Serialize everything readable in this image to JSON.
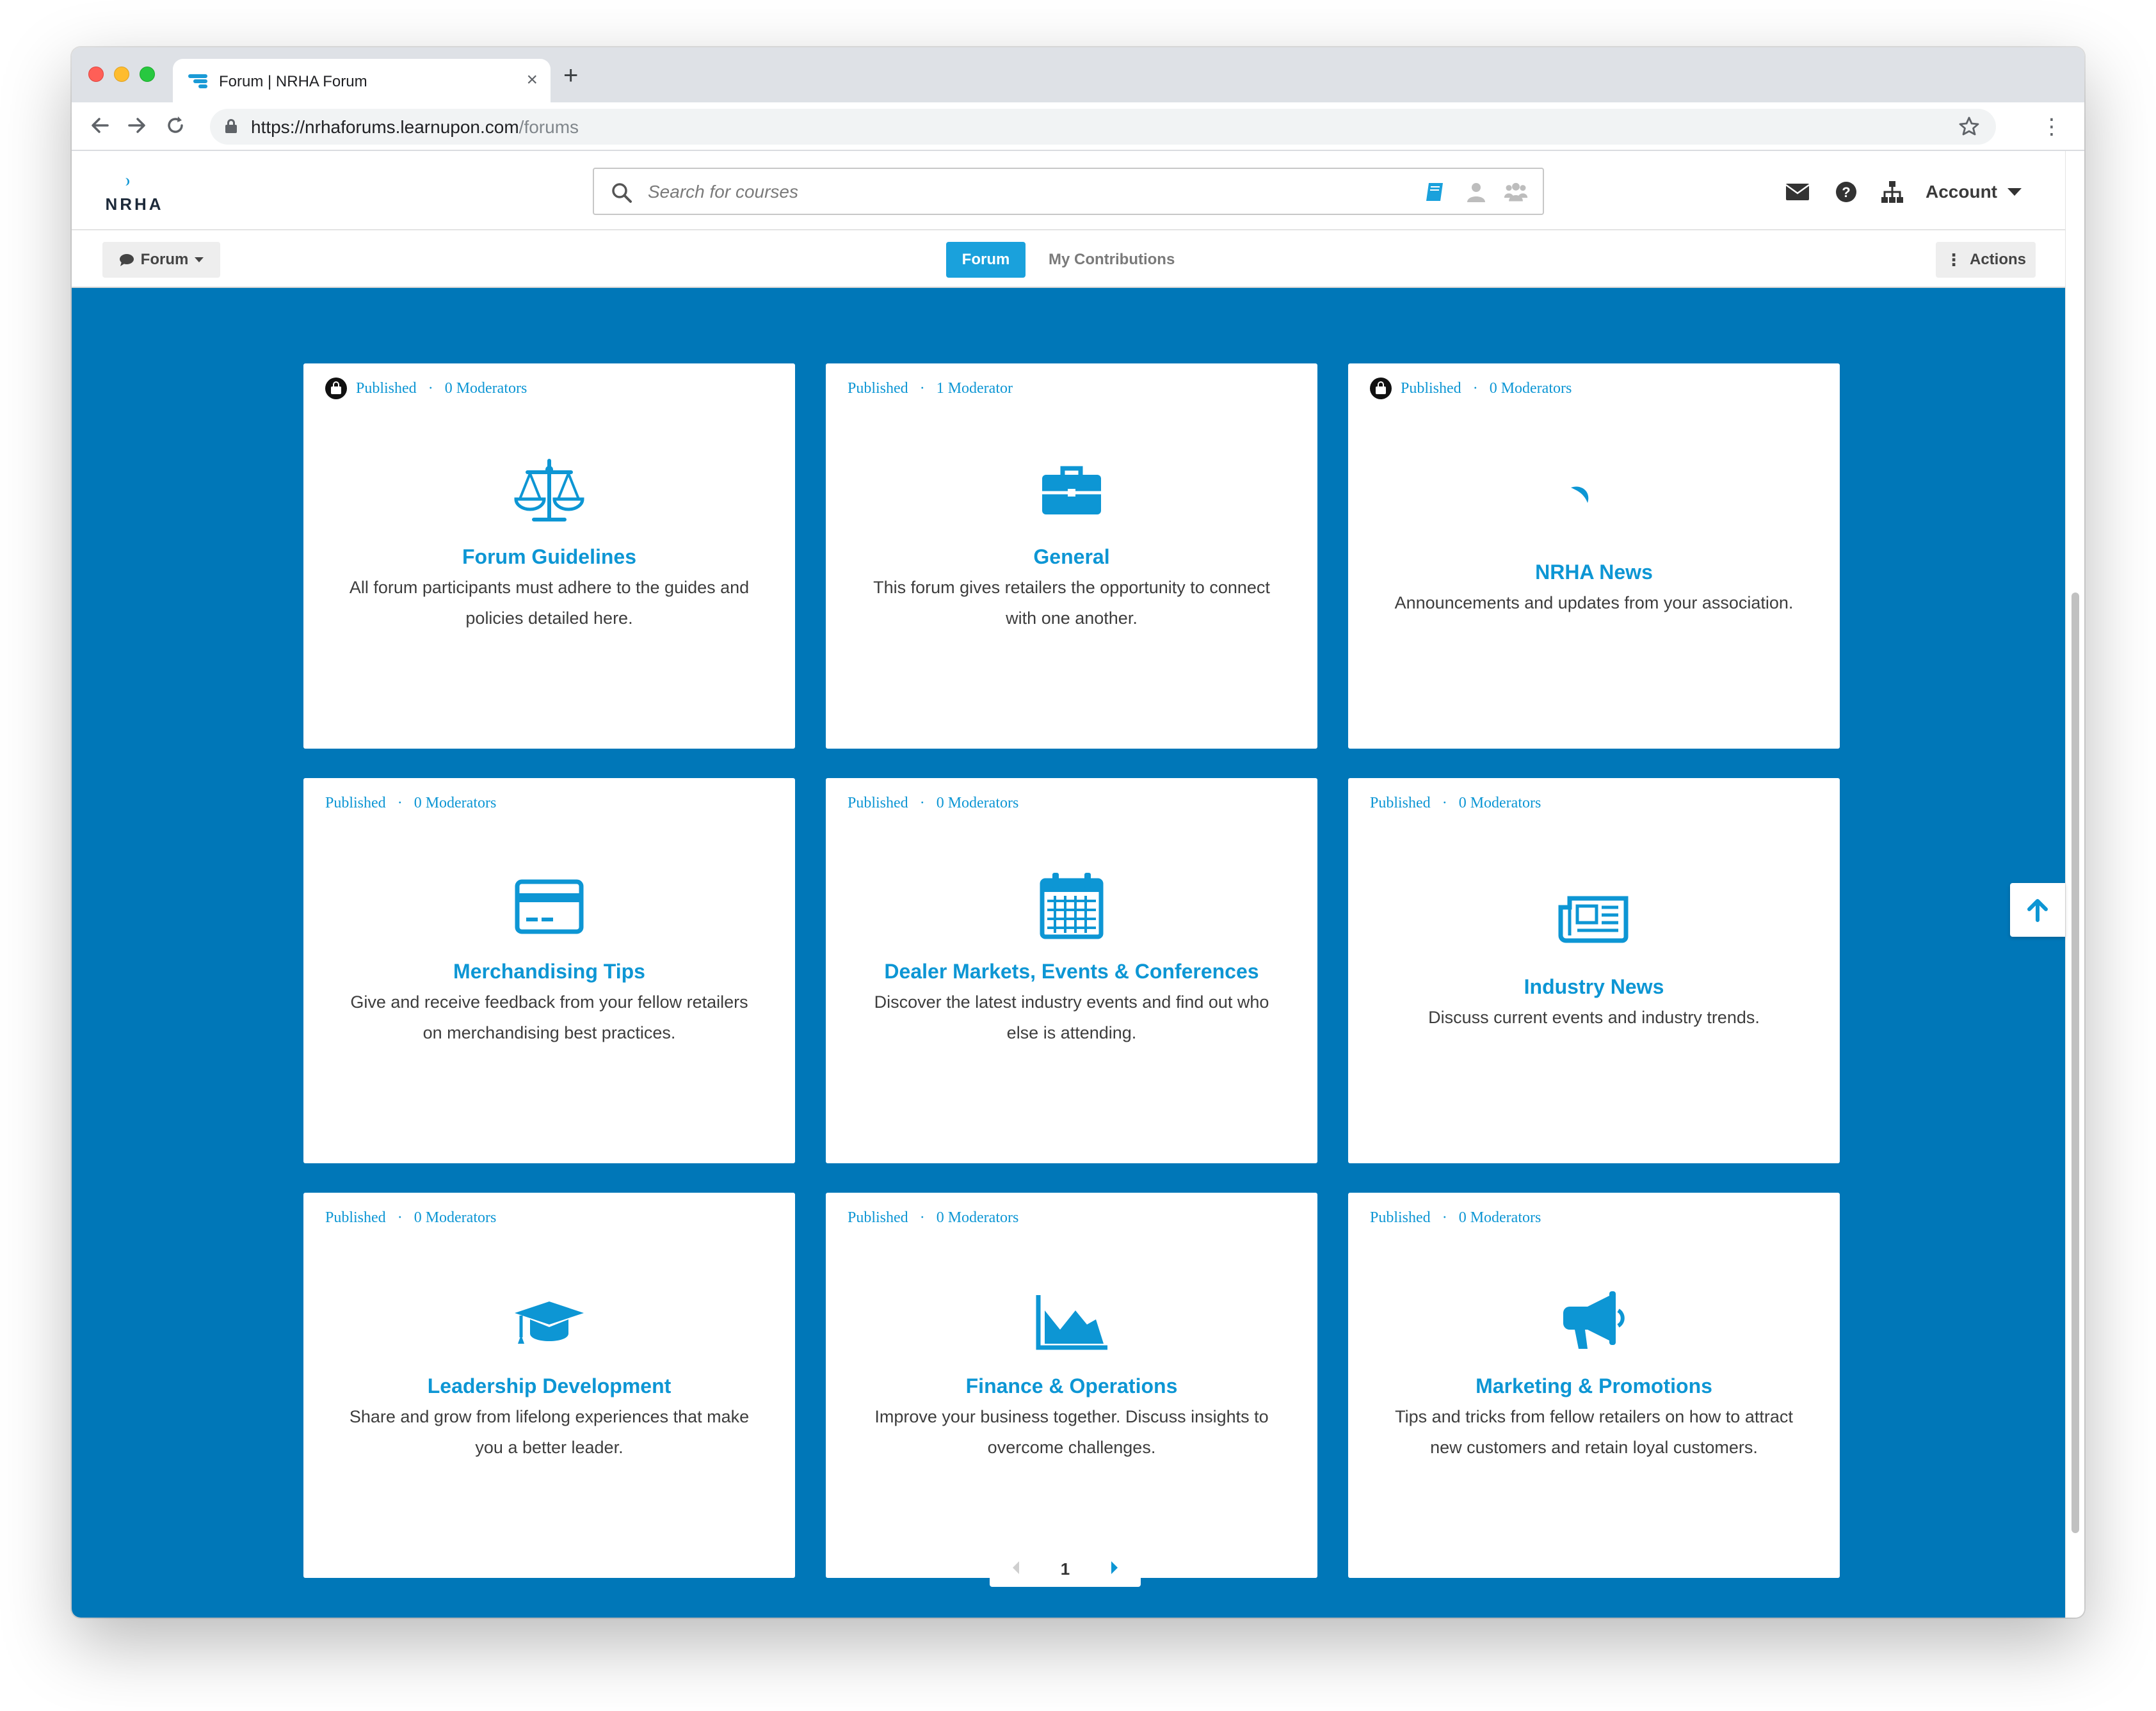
{
  "browser": {
    "tab_title": "Forum | NRHA Forum",
    "url_host": "https://nrhaforums.learnupon.com",
    "url_path": "/forums"
  },
  "header": {
    "logo_text": "NRHA",
    "search_placeholder": "Search for courses",
    "account_label": "Account"
  },
  "subnav": {
    "forum_dropdown": "Forum",
    "tabs": [
      {
        "label": "Forum",
        "active": true
      },
      {
        "label": "My Contributions",
        "active": false
      }
    ],
    "actions_label": "Actions"
  },
  "forums": [
    {
      "status": "Published",
      "moderators": "0 Moderators",
      "locked": true,
      "icon": "scale-icon",
      "title": "Forum Guidelines",
      "description": "All forum participants must adhere to the guides and policies detailed here."
    },
    {
      "status": "Published",
      "moderators": "1 Moderator",
      "locked": false,
      "icon": "briefcase-icon",
      "title": "General",
      "description": "This forum gives retailers the opportunity to connect with one another."
    },
    {
      "status": "Published",
      "moderators": "0 Moderators",
      "locked": true,
      "icon": "nrha-logo-icon",
      "title": "NRHA News",
      "description": "Announcements and updates from your association."
    },
    {
      "status": "Published",
      "moderators": "0 Moderators",
      "locked": false,
      "icon": "credit-card-icon",
      "title": "Merchandising Tips",
      "description": "Give and receive feedback from your fellow retailers on merchandising best practices."
    },
    {
      "status": "Published",
      "moderators": "0 Moderators",
      "locked": false,
      "icon": "calendar-icon",
      "title": "Dealer Markets, Events & Conferences",
      "description": "Discover the latest industry events and find out who else is attending."
    },
    {
      "status": "Published",
      "moderators": "0 Moderators",
      "locked": false,
      "icon": "newspaper-icon",
      "title": "Industry News",
      "description": "Discuss current events and industry trends."
    },
    {
      "status": "Published",
      "moderators": "0 Moderators",
      "locked": false,
      "icon": "graduation-cap-icon",
      "title": "Leadership Development",
      "description": "Share and grow from lifelong experiences that make you a better leader."
    },
    {
      "status": "Published",
      "moderators": "0 Moderators",
      "locked": false,
      "icon": "area-chart-icon",
      "title": "Finance & Operations",
      "description": "Improve your business together. Discuss insights to overcome challenges."
    },
    {
      "status": "Published",
      "moderators": "0 Moderators",
      "locked": false,
      "icon": "megaphone-icon",
      "title": "Marketing & Promotions",
      "description": "Tips and tricks from fellow retailers on how to attract new customers and retain loyal customers."
    }
  ],
  "pagination": {
    "current_page": "1"
  },
  "colors": {
    "page_background": "#0077b8",
    "accent": "#0d96d4",
    "active_tab": "#1aa1dc"
  }
}
